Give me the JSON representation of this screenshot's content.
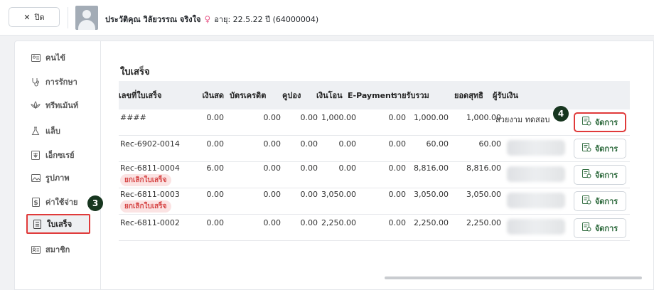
{
  "header": {
    "close_label": "ปิด",
    "patient_name": "ประวัติคุณ วิลัยวรรณ จริงใจ",
    "age_info": "อายุ: 22.5.22 ปี (64000004)"
  },
  "sidebar": {
    "items": [
      {
        "label": "คนไข้",
        "icon": "id-card-icon"
      },
      {
        "label": "การรักษา",
        "icon": "stethoscope-icon"
      },
      {
        "label": "ทรีทเม้นท์",
        "icon": "lotus-icon"
      },
      {
        "label": "แล็บ",
        "icon": "flask-icon"
      },
      {
        "label": "เอ็กซเรย์",
        "icon": "xray-icon"
      },
      {
        "label": "รูปภาพ",
        "icon": "image-icon"
      },
      {
        "label": "ค่าใช้จ่าย",
        "icon": "dollar-doc-icon"
      },
      {
        "label": "ใบเสร็จ",
        "icon": "receipt-icon"
      },
      {
        "label": "สมาชิก",
        "icon": "member-card-icon"
      }
    ],
    "active_index": 7
  },
  "steps": {
    "sidebar_step": "3",
    "manage_step": "4"
  },
  "main": {
    "section_title": "ใบเสร็จ",
    "columns": [
      "เลขที่ใบเสร็จ",
      "เงินสด",
      "บัตรเครดิต",
      "คูปอง",
      "เงินโอน",
      "E-Payment",
      "รายรับรวม",
      "ยอดสุทธิ",
      "ผู้รับเงิน"
    ],
    "rows": [
      {
        "receipt_no": "####",
        "cash": "0.00",
        "credit": "0.00",
        "coupon": "0.00",
        "transfer": "1,000.00",
        "epayment": "0.00",
        "total": "1,000.00",
        "net": "1,000.00",
        "receiver": "สวยงาม ทดสอบ",
        "cancel": ""
      },
      {
        "receipt_no": "Rec-6902-0014",
        "cash": "0.00",
        "credit": "0.00",
        "coupon": "0.00",
        "transfer": "0.00",
        "epayment": "0.00",
        "total": "60.00",
        "net": "60.00",
        "receiver": "",
        "cancel": ""
      },
      {
        "receipt_no": "Rec-6811-0004",
        "cash": "6.00",
        "credit": "0.00",
        "coupon": "0.00",
        "transfer": "0.00",
        "epayment": "0.00",
        "total": "8,816.00",
        "net": "8,816.00",
        "receiver": "",
        "cancel": "ยกเลิกใบเสร็จ"
      },
      {
        "receipt_no": "Rec-6811-0003",
        "cash": "0.00",
        "credit": "0.00",
        "coupon": "0.00",
        "transfer": "3,050.00",
        "epayment": "0.00",
        "total": "3,050.00",
        "net": "3,050.00",
        "receiver": "",
        "cancel": "ยกเลิกใบเสร็จ"
      },
      {
        "receipt_no": "Rec-6811-0002",
        "cash": "0.00",
        "credit": "0.00",
        "coupon": "0.00",
        "transfer": "2,250.00",
        "epayment": "0.00",
        "total": "2,250.00",
        "net": "2,250.00",
        "receiver": "",
        "cancel": ""
      }
    ],
    "action_label": "จัดการ"
  },
  "colors": {
    "accent": "#2f6b3e",
    "highlight": "#e03a3a",
    "badge": "#17361f",
    "cancel_bg": "#fbe3e3",
    "cancel_text": "#d64545"
  }
}
